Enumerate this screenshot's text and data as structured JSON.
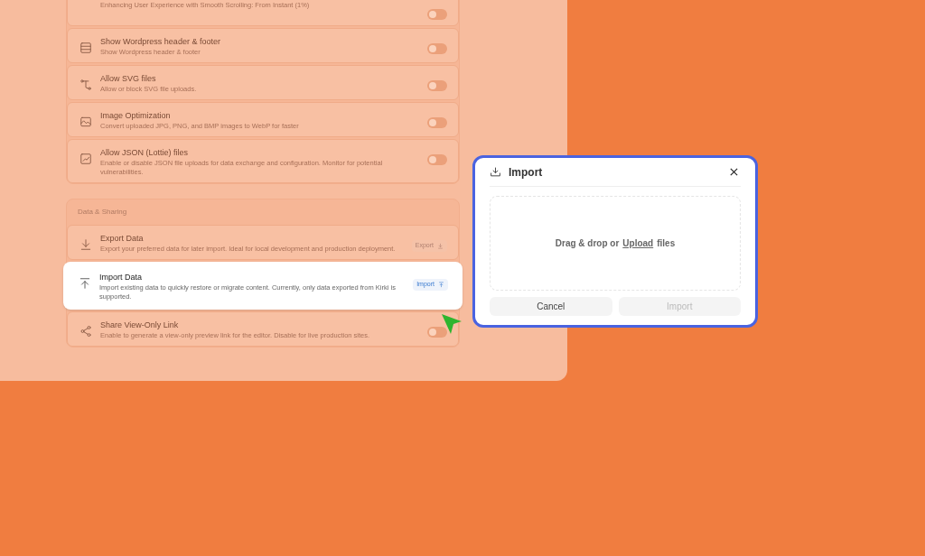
{
  "settings": {
    "sections": [
      {
        "items": [
          {
            "kind": "toggle",
            "description": "Enhancing User Experience with Smooth Scrolling: From Instant (1%)",
            "on": false,
            "selected": false
          },
          {
            "kind": "toggle",
            "title": "Show Wordpress header & footer",
            "description": "Show Wordpress header & footer",
            "on": false,
            "selected": false
          },
          {
            "kind": "toggle",
            "title": "Allow SVG files",
            "description": "Allow or block SVG file uploads.",
            "on": false,
            "selected": false
          },
          {
            "kind": "toggle",
            "title": "Image Optimization",
            "description": "Convert uploaded JPG, PNG, and BMP images to WebP for faster",
            "on": false,
            "selected": false
          },
          {
            "kind": "toggle",
            "title": "Allow JSON (Lottie) files",
            "description": "Enable or disable JSON file uploads for data exchange and configuration. Monitor for potential vulnerabilities.",
            "on": false,
            "selected": false
          }
        ]
      },
      {
        "heading": "Data & Sharing",
        "items": [
          {
            "kind": "button",
            "title": "Export Data",
            "description": "Export your preferred data for later import. Ideal for local development and production deployment.",
            "button": "Export",
            "selected": false
          },
          {
            "kind": "button",
            "title": "Import Data",
            "description": "Import existing data to quickly restore or migrate content. Currently, only data exported from Kirki is supported.",
            "button": "Import",
            "selected": true
          },
          {
            "kind": "toggle",
            "title": "Share View-Only Link",
            "description": "Enable to generate a view-only preview link for the editor. Disable for live production sites.",
            "on": false,
            "selected": false
          }
        ]
      }
    ]
  },
  "dialog": {
    "title": "Import",
    "dropzone": {
      "before": "Drag & drop or",
      "link": "Upload",
      "after": "files"
    },
    "buttons": [
      {
        "label": "Cancel",
        "disabled": false
      },
      {
        "label": "Import",
        "disabled": true
      }
    ]
  }
}
